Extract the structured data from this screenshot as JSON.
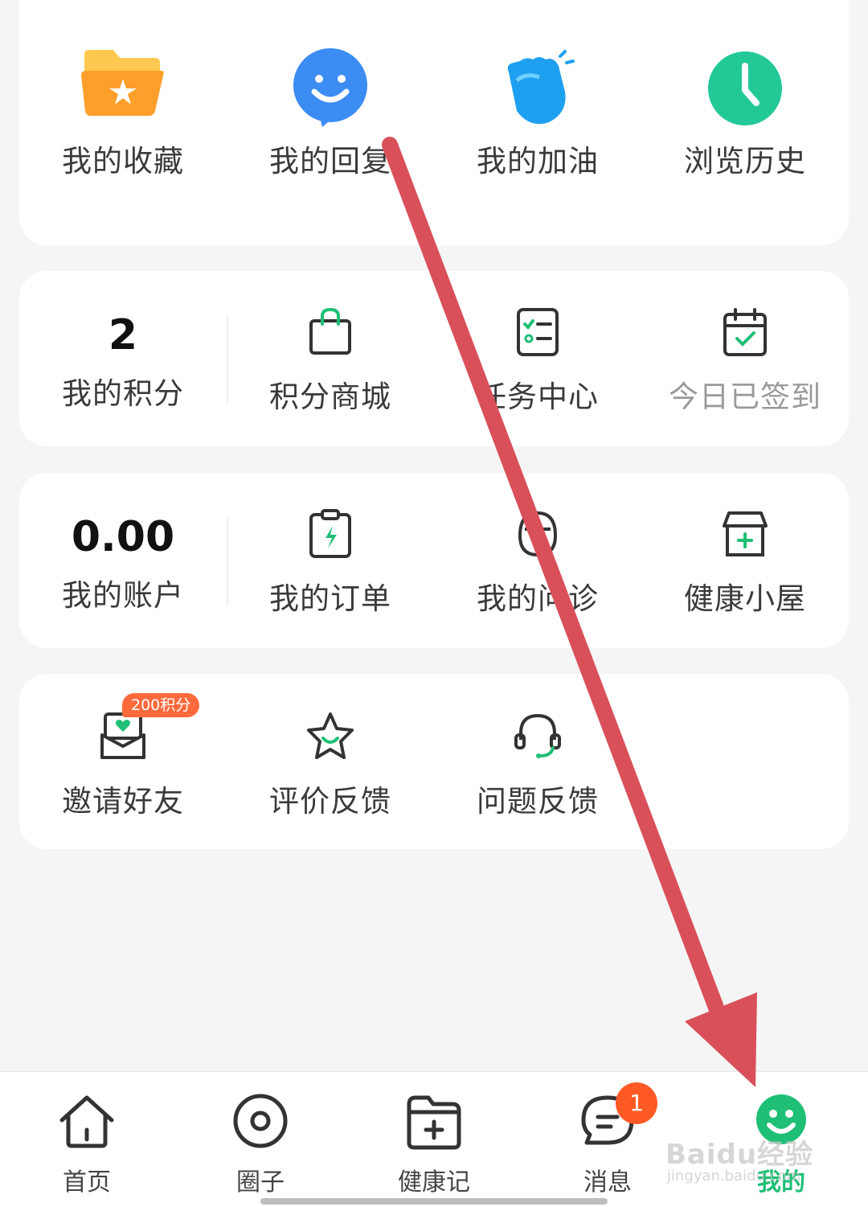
{
  "section1": {
    "items": [
      {
        "label": "我的收藏",
        "icon": "folder-star-icon"
      },
      {
        "label": "我的回复",
        "icon": "smile-chat-icon"
      },
      {
        "label": "我的加油",
        "icon": "clap-hand-icon"
      },
      {
        "label": "浏览历史",
        "icon": "clock-icon"
      }
    ]
  },
  "section2": {
    "points_value": "2",
    "points_label": "我的积分",
    "items": [
      {
        "label": "积分商城",
        "icon": "shopping-bag-icon"
      },
      {
        "label": "任务中心",
        "icon": "task-list-icon"
      },
      {
        "label": "今日已签到",
        "icon": "calendar-check-icon"
      }
    ]
  },
  "section3": {
    "account_value": "0.00",
    "account_label": "我的账户",
    "items": [
      {
        "label": "我的订单",
        "icon": "order-clipboard-icon"
      },
      {
        "label": "我的问诊",
        "icon": "doctor-icon"
      },
      {
        "label": "健康小屋",
        "icon": "health-store-icon"
      }
    ]
  },
  "section4": {
    "items": [
      {
        "label": "邀请好友",
        "icon": "invite-envelope-icon",
        "badge": "200积分"
      },
      {
        "label": "评价反馈",
        "icon": "star-smile-icon"
      },
      {
        "label": "问题反馈",
        "icon": "headset-icon"
      }
    ]
  },
  "tabbar": {
    "tabs": [
      {
        "label": "首页",
        "icon": "home-icon"
      },
      {
        "label": "圈子",
        "icon": "circle-icon"
      },
      {
        "label": "健康记",
        "icon": "folder-plus-icon"
      },
      {
        "label": "消息",
        "icon": "message-icon",
        "badge": "1"
      },
      {
        "label": "我的",
        "icon": "smile-profile-icon",
        "active": true
      }
    ]
  },
  "watermark": {
    "text": "Baidu经验",
    "sub": "jingyan.baidu.com"
  },
  "colors": {
    "accent": "#1fbf76",
    "badge": "#ff6a3d",
    "arrow": "#d9505a"
  }
}
